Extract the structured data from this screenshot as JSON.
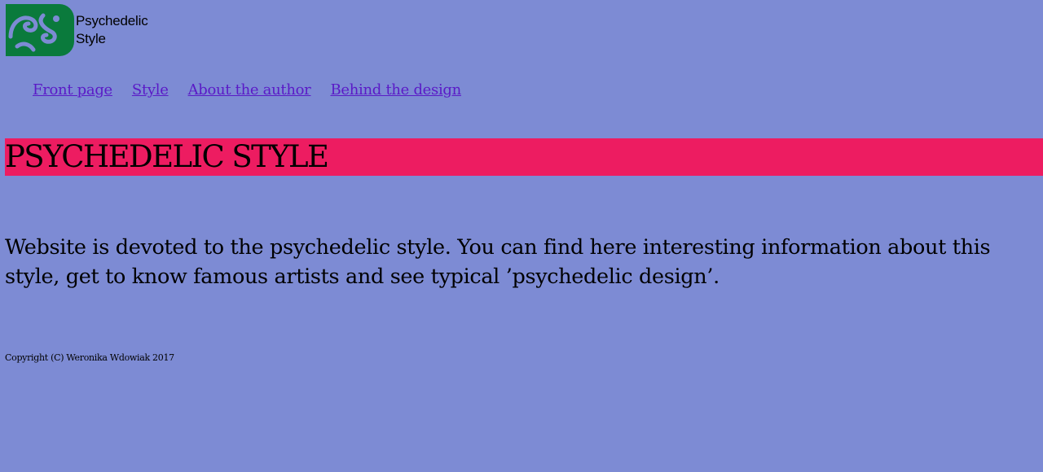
{
  "brand": {
    "logo_icon": "psychedelic-swirl-logo",
    "logo_color": "#0a7a3c",
    "title_line1": "Psychedelic",
    "title_line2": "Style"
  },
  "nav": {
    "items": [
      {
        "label": "Front page"
      },
      {
        "label": "Style"
      },
      {
        "label": "About the author"
      },
      {
        "label": "Behind the design"
      }
    ]
  },
  "banner": {
    "title": "PSYCHEDELIC STYLE",
    "color": "#ed1c61"
  },
  "main": {
    "intro": "Website is devoted to the psychedelic style. You can find here interesting information about this style, get to know famous artists and see typical ’psychedelic design’."
  },
  "footer": {
    "copyright": "Copyright (C) Weronika Wdowiak 2017"
  },
  "colors": {
    "background": "#7d8bd4",
    "link": "#5a1ac7"
  }
}
